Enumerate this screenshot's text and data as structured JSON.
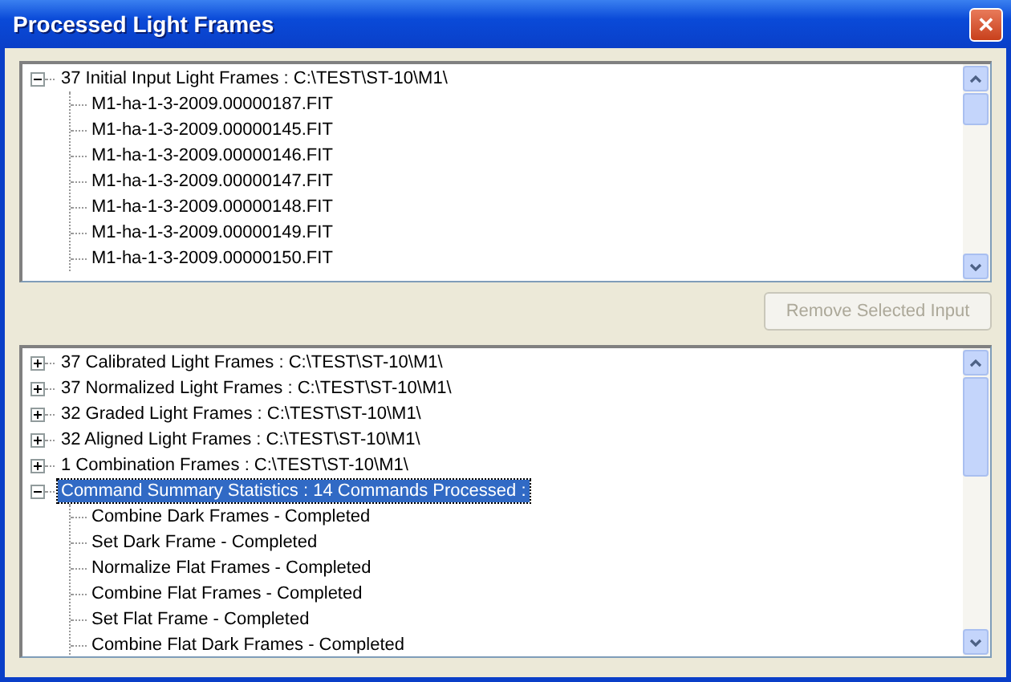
{
  "window": {
    "title": "Processed Light Frames",
    "close": "✕"
  },
  "input_tree": {
    "items": [
      {
        "label": "37 Initial Input Light Frames : C:\\TEST\\ST-10\\M1\\",
        "expanded": true,
        "selected": false,
        "children": [
          {
            "label": "M1-ha-1-3-2009.00000187.FIT",
            "selected": false
          },
          {
            "label": "M1-ha-1-3-2009.00000145.FIT",
            "selected": false
          },
          {
            "label": "M1-ha-1-3-2009.00000146.FIT",
            "selected": false
          },
          {
            "label": "M1-ha-1-3-2009.00000147.FIT",
            "selected": false
          },
          {
            "label": "M1-ha-1-3-2009.00000148.FIT",
            "selected": false
          },
          {
            "label": "M1-ha-1-3-2009.00000149.FIT",
            "selected": false
          },
          {
            "label": "M1-ha-1-3-2009.00000150.FIT",
            "selected": false
          }
        ]
      }
    ]
  },
  "remove_button": {
    "label": "Remove Selected Input",
    "disabled": true
  },
  "results_tree": {
    "items": [
      {
        "label": "37 Calibrated Light Frames : C:\\TEST\\ST-10\\M1\\",
        "expanded": false,
        "selected": false
      },
      {
        "label": "37 Normalized Light Frames : C:\\TEST\\ST-10\\M1\\",
        "expanded": false,
        "selected": false
      },
      {
        "label": "32 Graded Light Frames : C:\\TEST\\ST-10\\M1\\",
        "expanded": false,
        "selected": false
      },
      {
        "label": "32 Aligned Light Frames : C:\\TEST\\ST-10\\M1\\",
        "expanded": false,
        "selected": false
      },
      {
        "label": "1 Combination Frames : C:\\TEST\\ST-10\\M1\\",
        "expanded": false,
        "selected": false
      },
      {
        "label": "Command Summary Statistics : 14 Commands Processed :",
        "expanded": true,
        "selected": true,
        "children": [
          {
            "label": "Combine Dark Frames - Completed",
            "selected": false
          },
          {
            "label": "Set Dark Frame - Completed",
            "selected": false
          },
          {
            "label": "Normalize Flat Frames - Completed",
            "selected": false
          },
          {
            "label": "Combine Flat Frames - Completed",
            "selected": false
          },
          {
            "label": "Set Flat Frame - Completed",
            "selected": false
          },
          {
            "label": "Combine Flat Dark Frames - Completed",
            "selected": false
          }
        ]
      }
    ]
  }
}
